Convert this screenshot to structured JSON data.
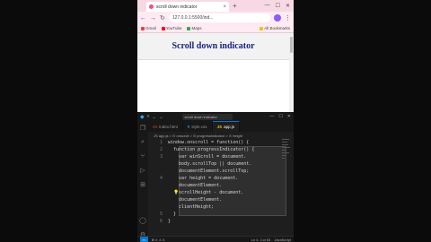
{
  "browser": {
    "tab_title": "scroll down indicator",
    "tab_close": "×",
    "new_tab": "+",
    "window_controls": [
      "—",
      "☐",
      "✕"
    ],
    "back": "←",
    "forward": "→",
    "reload": "↻",
    "url": "127.0.0.1:5500/ind...",
    "bookmarks": [
      {
        "label": "Gmail",
        "color": "#ea4335"
      },
      {
        "label": "YouTube",
        "color": "#ff0000"
      },
      {
        "label": "Maps",
        "color": "#34a853"
      },
      {
        "label": "Fixed",
        "color": "#fbbc05"
      }
    ],
    "all_bookmarks": "All Bookmarks"
  },
  "webpage": {
    "heading": "Scroll down indicator"
  },
  "vscode": {
    "title_search": "scroll down indicator",
    "menu": "≡",
    "win_buttons": [
      "—",
      "☐",
      "✕"
    ],
    "tabs": [
      {
        "icon": "<>",
        "label": "index.html",
        "active": false
      },
      {
        "icon": "#",
        "label": "style.css",
        "active": false
      },
      {
        "icon": "JS",
        "label": "app.js",
        "active": true
      }
    ],
    "breadcrumb": "JS app.js > ⊙ onscroll > ⊙ progressIndicator > ⊙ height",
    "lines": [
      {
        "n": "1",
        "text": "window.onscroll = function() {"
      },
      {
        "n": "2",
        "text": "  function progressIndicator() {"
      },
      {
        "n": "3",
        "text": "    var winScroll = document."
      },
      {
        "n": "",
        "text": "    body.scrollTop || document."
      },
      {
        "n": "",
        "text": "    documentElement.scrollTop;"
      },
      {
        "n": "4",
        "text": "    var height = document."
      },
      {
        "n": "",
        "text": "    documentElement."
      },
      {
        "n": "",
        "text": "    scrollHeight - document."
      },
      {
        "n": "",
        "text": "    documentElement."
      },
      {
        "n": "",
        "text": "    clientHeight;"
      },
      {
        "n": "5",
        "text": "  }"
      },
      {
        "n": "6",
        "text": "}"
      }
    ],
    "status": {
      "remote": "><",
      "errors": "⊗ 0 ⚠ 0",
      "position": "Ln 4, Col 83",
      "lang": "JavaScript"
    }
  }
}
